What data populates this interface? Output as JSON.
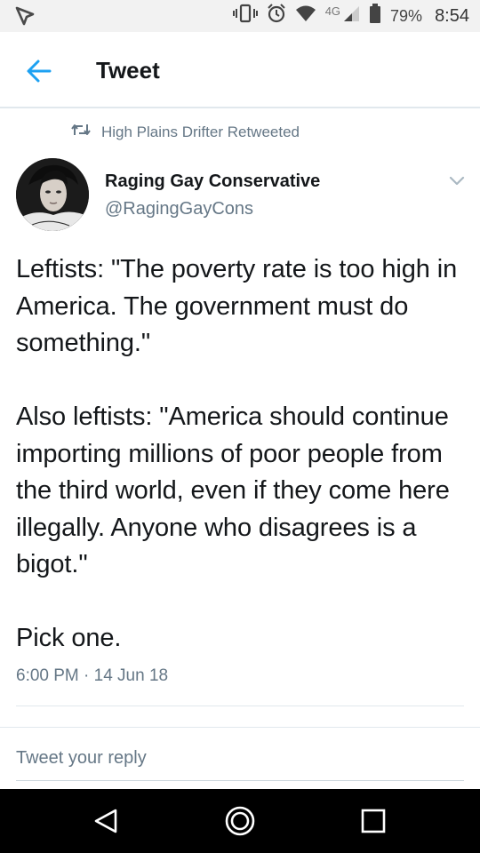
{
  "status_bar": {
    "network": "4G",
    "battery_percent": "79%",
    "time": "8:54"
  },
  "app_bar": {
    "title": "Tweet"
  },
  "retweet_banner": "High Plains Drifter Retweeted",
  "author": {
    "name": "Raging Gay Conservative",
    "handle": "@RagingGayCons"
  },
  "tweet": {
    "text": "Leftists: \"The poverty rate is too high in America. The government must do something.\"\n\nAlso leftists: \"America should continue importing millions of poor people from the third world, even if they come here illegally. Anyone who disagrees is a bigot.\"\n\nPick one.",
    "timestamp": "6:00 PM · 14 Jun 18"
  },
  "reply_box": {
    "placeholder": "Tweet your reply"
  },
  "colors": {
    "accent": "#1da1f2",
    "muted": "#657786",
    "text": "#14171a"
  }
}
